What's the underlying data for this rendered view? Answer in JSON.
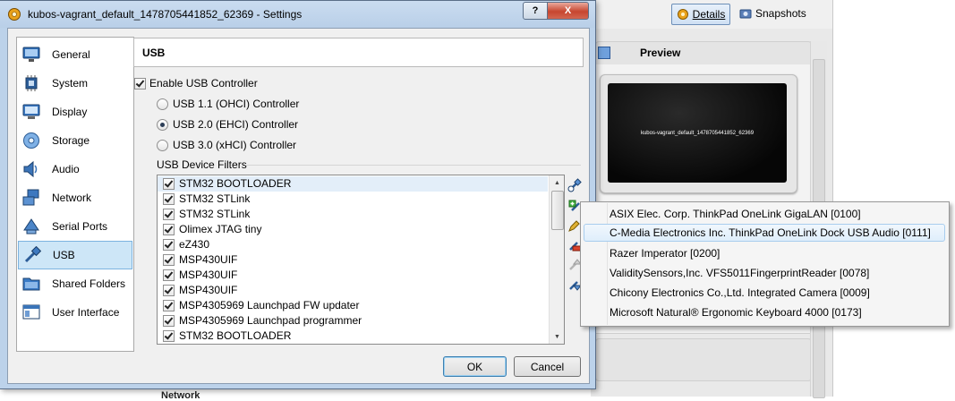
{
  "background": {
    "toolbar": {
      "details_label": "Details",
      "snapshots_label": "Snapshots"
    },
    "preview": {
      "title": "Preview",
      "screen_text": "kubos-vagrant_default_1478705441852_62369"
    },
    "network_label": "Network"
  },
  "dialog": {
    "title": "kubos-vagrant_default_1478705441852_62369 - Settings",
    "help_label": "?",
    "close_label": "X",
    "sidebar": [
      {
        "label": "General"
      },
      {
        "label": "System"
      },
      {
        "label": "Display"
      },
      {
        "label": "Storage"
      },
      {
        "label": "Audio"
      },
      {
        "label": "Network"
      },
      {
        "label": "Serial Ports"
      },
      {
        "label": "USB",
        "selected": true
      },
      {
        "label": "Shared Folders"
      },
      {
        "label": "User Interface"
      }
    ],
    "page_title": "USB",
    "enable_usb_label": "Enable USB Controller",
    "enable_usb_checked": true,
    "controllers": [
      {
        "label": "USB 1.1 (OHCI) Controller",
        "selected": false
      },
      {
        "label": "USB 2.0 (EHCI) Controller",
        "selected": true
      },
      {
        "label": "USB 3.0 (xHCI) Controller",
        "selected": false
      }
    ],
    "filters_label": "USB Device Filters",
    "filters": [
      {
        "label": "STM32 BOOTLOADER",
        "checked": true
      },
      {
        "label": "STM32 STLink",
        "checked": true
      },
      {
        "label": "STM32 STLink",
        "checked": true
      },
      {
        "label": "Olimex JTAG tiny",
        "checked": true
      },
      {
        "label": "eZ430",
        "checked": true
      },
      {
        "label": "MSP430UIF",
        "checked": true
      },
      {
        "label": "MSP430UIF",
        "checked": true
      },
      {
        "label": "MSP430UIF",
        "checked": true
      },
      {
        "label": "MSP4305969 Launchpad FW updater",
        "checked": true
      },
      {
        "label": "MSP4305969 Launchpad programmer",
        "checked": true
      },
      {
        "label": "STM32 BOOTLOADER",
        "checked": true
      }
    ],
    "ok_label": "OK",
    "cancel_label": "Cancel"
  },
  "popup_menu": {
    "items": [
      {
        "label": "ASIX Elec. Corp. ThinkPad OneLink GigaLAN [0100]"
      },
      {
        "label": "C-Media Electronics Inc. ThinkPad OneLink Dock USB Audio [0111]",
        "highlighted": true
      },
      {
        "label": "Razer Imperator [0200]"
      },
      {
        "label": "ValiditySensors,Inc. VFS5011FingerprintReader [0078]"
      },
      {
        "label": "Chicony Electronics Co.,Ltd. Integrated Camera [0009]"
      },
      {
        "label": "Microsoft Natural® Ergonomic Keyboard 4000 [0173]"
      }
    ]
  },
  "colors": {
    "selection": "#cde6f7",
    "titlebar": "#bcd2ea",
    "close_button": "#c7462f",
    "menu_highlight": "#dfeefb"
  }
}
